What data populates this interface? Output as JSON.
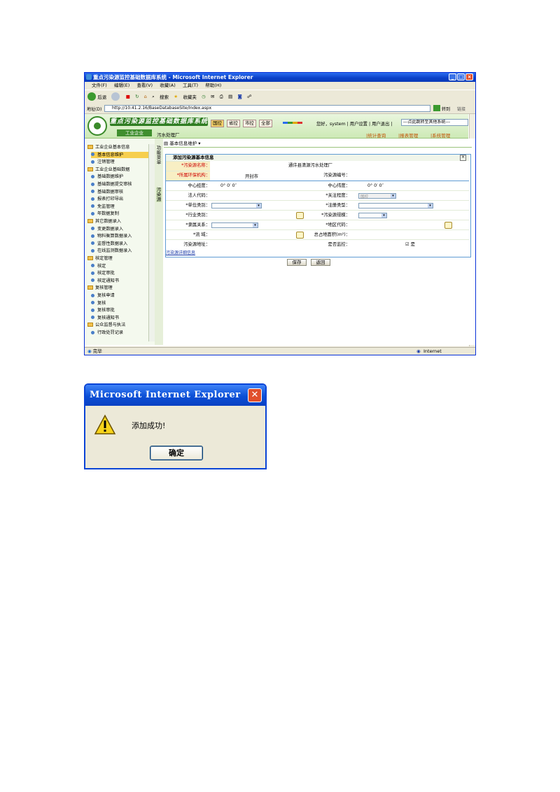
{
  "window": {
    "title": "重点污染源监控基础数据库系统 - Microsoft Internet Explorer"
  },
  "menu": [
    "文件(F)",
    "编辑(E)",
    "查看(V)",
    "收藏(A)",
    "工具(T)",
    "帮助(H)"
  ],
  "toolbar": {
    "back": "后退",
    "search": "搜索",
    "favorites": "收藏夹"
  },
  "address": {
    "label": "地址(D)",
    "url": "http://10.41.2.16/BaseDatabaseSite/Index.aspx",
    "go": "转到",
    "links": "链接"
  },
  "header": {
    "system_title": "重点污染源监控基础数据库系统",
    "scopes": [
      "国控",
      "省控",
      "市控",
      "全部"
    ],
    "greeting": "您好，system | 用户设置 | 用户退出 |",
    "jump_select": "---点此跳转至其他系统---",
    "section_tab": "工业企业",
    "current": "污水处理厂",
    "links": [
      "|统计查询",
      "|报表管理",
      "|系统管理"
    ]
  },
  "nav": {
    "items": [
      {
        "type": "group",
        "label": "工业企业基本信息"
      },
      {
        "type": "item",
        "label": "基本信息维护",
        "selected": true
      },
      {
        "type": "item",
        "label": "注销管理"
      },
      {
        "type": "group",
        "label": "工业企业基础数据"
      },
      {
        "type": "item",
        "label": "基础数据维护"
      },
      {
        "type": "item",
        "label": "基础数据提交审核"
      },
      {
        "type": "item",
        "label": "基础数据审核"
      },
      {
        "type": "item",
        "label": "报表打印导出"
      },
      {
        "type": "item",
        "label": "免监管理"
      },
      {
        "type": "item",
        "label": "年数据复制"
      },
      {
        "type": "group",
        "label": "其它数据录入"
      },
      {
        "type": "item",
        "label": "变更数据录入"
      },
      {
        "type": "item",
        "label": "物料衡算数据录入"
      },
      {
        "type": "item",
        "label": "监督性数据录入"
      },
      {
        "type": "item",
        "label": "在线监测数据录入"
      },
      {
        "type": "group",
        "label": "核定管理"
      },
      {
        "type": "item",
        "label": "核定"
      },
      {
        "type": "item",
        "label": "核定审批"
      },
      {
        "type": "item",
        "label": "核定通知书"
      },
      {
        "type": "group",
        "label": "复核管理"
      },
      {
        "type": "item",
        "label": "复核申请"
      },
      {
        "type": "item",
        "label": "复核"
      },
      {
        "type": "item",
        "label": "复核审批"
      },
      {
        "type": "item",
        "label": "复核通知书"
      },
      {
        "type": "group",
        "label": "公众监督与执法"
      },
      {
        "type": "item",
        "label": "行政处罚记录"
      }
    ],
    "side_tab_top": "功能菜单",
    "side_tab_bottom": "污染源"
  },
  "main": {
    "tab": "基本信息维护",
    "form": {
      "title": "添加污染源基本信息",
      "name_label": "*污染源名称：",
      "name_value": "通许县清源污水处理厂",
      "org_label": "*所属环保机构：",
      "org_value": "开封市",
      "code_label": "污染源编号：",
      "lng_label": "中心经度：",
      "lng_value": "0°  0′  0″",
      "lat_label": "中心纬度：",
      "lat_value": "0°  0′  0″",
      "legal_label": "法人代码：",
      "attention_label": "*关注程度：",
      "attention_value": "国控",
      "unit_type_label": "*单位类别：",
      "reg_type_label": "*注册类型：",
      "industry_label": "*行业类别：",
      "scale_label": "*污染源规模：",
      "affil_label": "*隶属关系：",
      "region_label": "*地区代码：",
      "basin_label": "*流    域：",
      "area_label": "总占地面积(m²)：",
      "address_label": "污染源地址：",
      "monitored_label": "是否监控：",
      "monitored_value": "是",
      "detail_link": "污染源详细信息",
      "save": "保存",
      "back": "返回"
    }
  },
  "statusbar": {
    "left": "完毕",
    "right": "Internet"
  },
  "dialog": {
    "title": "Microsoft Internet Explorer",
    "message": "添加成功!",
    "ok": "确定",
    "close": "✕"
  }
}
